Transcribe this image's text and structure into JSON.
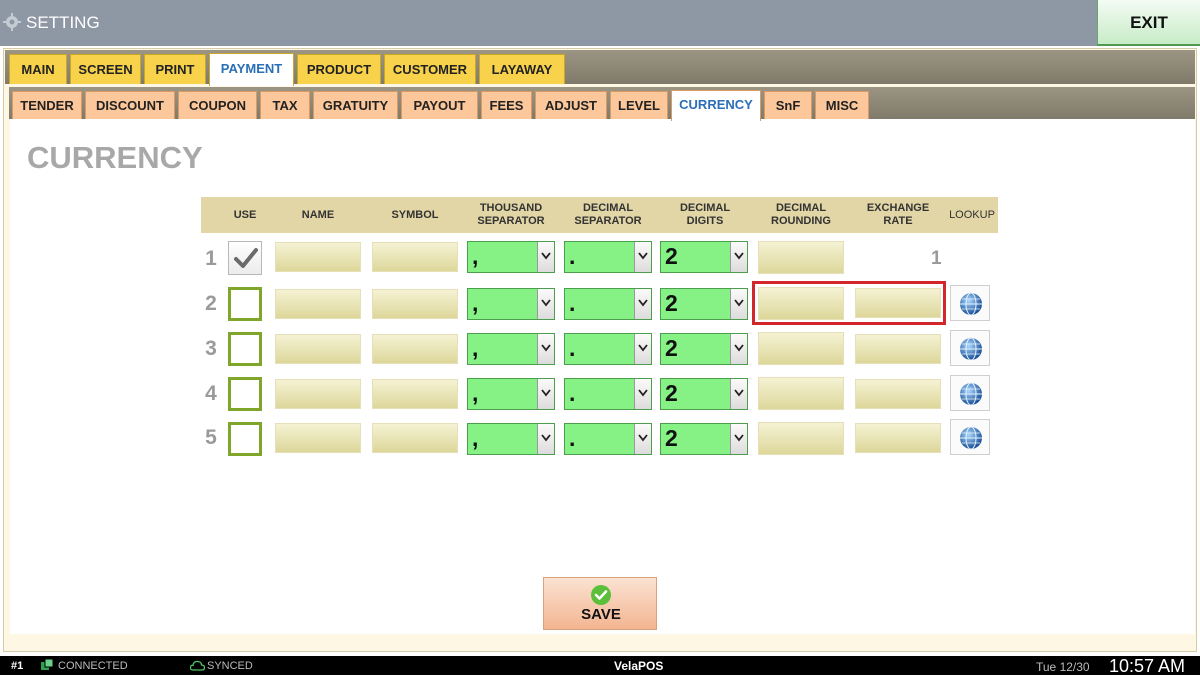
{
  "titlebar": {
    "title": "SETTING",
    "exit_label": "EXIT"
  },
  "tabs_primary": [
    "MAIN",
    "SCREEN",
    "PRINT",
    "PAYMENT",
    "PRODUCT",
    "CUSTOMER",
    "LAYAWAY"
  ],
  "tabs_primary_active": "PAYMENT",
  "tabs_secondary": [
    "TENDER",
    "DISCOUNT",
    "COUPON",
    "TAX",
    "GRATUITY",
    "PAYOUT",
    "FEES",
    "ADJUST",
    "LEVEL",
    "CURRENCY",
    "SnF",
    "MISC"
  ],
  "tabs_secondary_active": "CURRENCY",
  "page_title": "CURRENCY",
  "table": {
    "headers": {
      "use": "USE",
      "name": "NAME",
      "symbol": "SYMBOL",
      "thousand_1": "THOUSAND",
      "thousand_2": "SEPARATOR",
      "decimal_sep_1": "DECIMAL",
      "decimal_sep_2": "SEPARATOR",
      "decimal_digits_1": "DECIMAL",
      "decimal_digits_2": "DIGITS",
      "decimal_rounding_1": "DECIMAL",
      "decimal_rounding_2": "ROUNDING",
      "exchange_1": "EXCHANGE",
      "exchange_2": "RATE",
      "lookup": "LOOKUP"
    },
    "rows": [
      {
        "num": "1",
        "use": true,
        "name": "",
        "symbol": "",
        "thousand_sep": ",",
        "decimal_sep": ".",
        "decimal_digits": "2",
        "decimal_rounding": "",
        "exchange_rate": "1"
      },
      {
        "num": "2",
        "use": false,
        "name": "",
        "symbol": "",
        "thousand_sep": ",",
        "decimal_sep": ".",
        "decimal_digits": "2",
        "decimal_rounding": "",
        "exchange_rate": ""
      },
      {
        "num": "3",
        "use": false,
        "name": "",
        "symbol": "",
        "thousand_sep": ",",
        "decimal_sep": ".",
        "decimal_digits": "2",
        "decimal_rounding": "",
        "exchange_rate": ""
      },
      {
        "num": "4",
        "use": false,
        "name": "",
        "symbol": "",
        "thousand_sep": ",",
        "decimal_sep": ".",
        "decimal_digits": "2",
        "decimal_rounding": "",
        "exchange_rate": ""
      },
      {
        "num": "5",
        "use": false,
        "name": "",
        "symbol": "",
        "thousand_sep": ",",
        "decimal_sep": ".",
        "decimal_digits": "2",
        "decimal_rounding": "",
        "exchange_rate": ""
      }
    ]
  },
  "save_label": "SAVE",
  "statusbar": {
    "station": "#1",
    "connection": "CONNECTED",
    "sync": "SYNCED",
    "brand": "VelaPOS",
    "date": "Tue 12/30",
    "time": "10:57 AM"
  },
  "colors": {
    "titlebar": "#8e97a4",
    "tab_primary": "#f7d24a",
    "tab_secondary": "#fcc79a",
    "active_tab_text": "#2a6fb8",
    "dropdown_bg": "#86f286",
    "highlight": "#d3262c"
  }
}
